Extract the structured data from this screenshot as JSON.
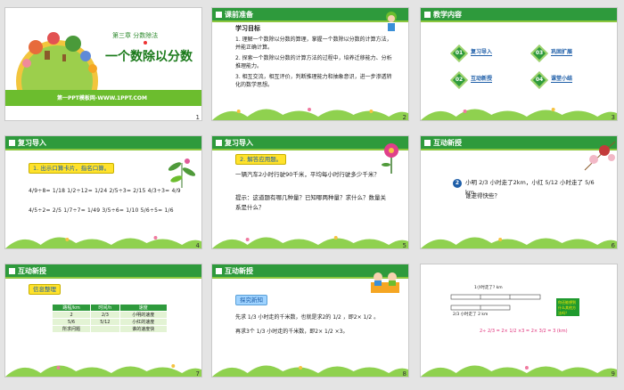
{
  "slides": [
    {
      "number": "1",
      "chapter": "第三章  分数除法",
      "title": "一个数除以分数",
      "site": "第一PPT模板网-WWW.1PPT.COM"
    },
    {
      "number": "2",
      "header": "课前准备",
      "subheading": "学习目标",
      "goals": [
        "1. 理解一个数除以分数的算理，掌握一个数除以分数的计算方法，并能正确计算。",
        "2. 探索一个数除以分数的计算方法的过程中，培养迁移能力、分析推理能力。",
        "3. 相互交流，相互评价，判断推理能力和抽象意识，进一步渗透转化的数学思想。"
      ]
    },
    {
      "number": "3",
      "header": "教学内容",
      "items": [
        {
          "n": "01",
          "label": "复习导入"
        },
        {
          "n": "02",
          "label": "互动新授"
        },
        {
          "n": "03",
          "label": "巩固扩展"
        },
        {
          "n": "04",
          "label": "课堂小结"
        }
      ]
    },
    {
      "number": "4",
      "header": "复习导入",
      "pill": "1. 出示口算卡片，指名口算。",
      "row1": "4/9÷8=  1/18   1/2÷12=  1/24   2/5÷3=  2/15   4/3÷3=  4/9",
      "row2": "4/5÷2=  2/5    1/7÷7=  1/49    3/5÷6=  1/10   5/6÷5=  1/6"
    },
    {
      "number": "5",
      "header": "复习导入",
      "pill": "2. 解答应用题。",
      "q": "一辆汽车2小时行驶90千米，平均每小时行驶多少千米？",
      "hint": "提示：这道题有哪几种量？已知哪两种量？求什么？数量关系是什么？"
    },
    {
      "number": "6",
      "header": "互动新授",
      "badge": "2",
      "q": "小明 2/3 小时走了2km，小红 5/12 小时走了 5/6 km。",
      "q2": "谁走得快些？"
    },
    {
      "number": "7",
      "header": "互动新授",
      "pill": "信息整理",
      "table_head": [
        "路程/km",
        "时间/h",
        "速度"
      ],
      "table_rows": [
        [
          "2",
          "2/3",
          "小明的速度"
        ],
        [
          "5/6",
          "5/12",
          "小红的速度"
        ],
        [
          "所求问题",
          "",
          "谁的速度快"
        ]
      ]
    },
    {
      "number": "8",
      "header": "互动新授",
      "pill": "探究新知",
      "l1": "先求 1/3 小时走的千米数，也就是求2的 1/2 ，即2× 1/2 。",
      "l2": "再求3个 1/3 小时走的千米数，即2× 1/2 ×3。"
    },
    {
      "number": "9",
      "label_top": "1小时走了? km",
      "label_bottom": "2/3 小时走了 2 km",
      "box": "你还能想到什么其他方法吗？",
      "formula": "2÷ 2/3 = 2× 1/2 ×3 = 2× 3/2 = 3 (km)"
    }
  ],
  "colors": {
    "accent_green": "#2e9a3c",
    "light_green": "#8cc63f",
    "pill_yellow": "#ffe22b",
    "text_blue": "#1e5ea8"
  }
}
